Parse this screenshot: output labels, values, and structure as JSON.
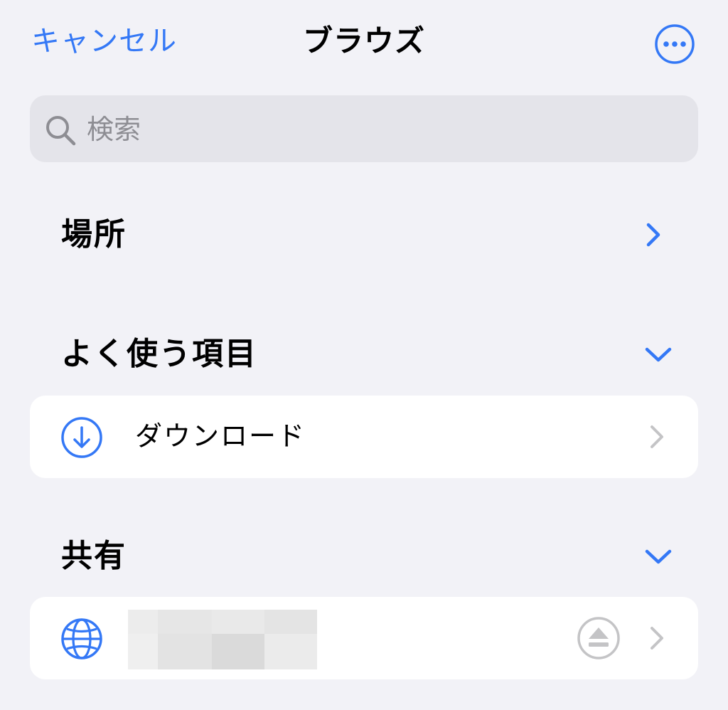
{
  "nav": {
    "cancel_label": "キャンセル",
    "title": "ブラウズ",
    "more_icon": "ellipsis-circle-icon"
  },
  "search": {
    "placeholder": "検索",
    "value": ""
  },
  "sections": {
    "locations": {
      "title": "場所",
      "chevron": "chevron-right-icon"
    },
    "favorites": {
      "title": "よく使う項目",
      "chevron": "chevron-down-icon",
      "items": [
        {
          "label": "ダウンロード",
          "icon": "download-circle-icon"
        }
      ]
    },
    "shared": {
      "title": "共有",
      "chevron": "chevron-down-icon",
      "items": [
        {
          "label": "",
          "icon": "globe-icon",
          "accessory": "eject-icon"
        }
      ]
    }
  },
  "colors": {
    "accent": "#3478f6",
    "background": "#f2f2f7",
    "card": "#ffffff",
    "search_fill": "#e4e4ea",
    "placeholder": "#8d8d93",
    "chevron_gray": "#c4c4c6"
  }
}
